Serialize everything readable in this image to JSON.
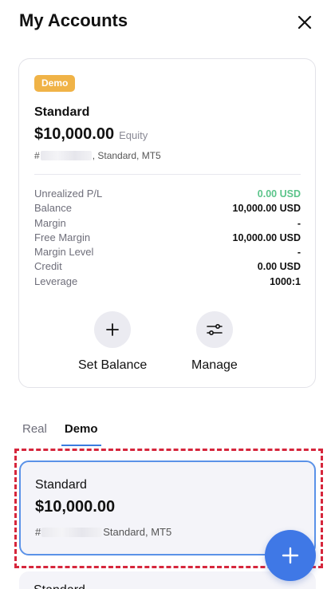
{
  "header": {
    "title": "My Accounts"
  },
  "account": {
    "badge": "Demo",
    "type": "Standard",
    "balance": "$10,000.00",
    "balance_label": "Equity",
    "id_prefix": "#",
    "meta": ", Standard, MT5",
    "stats": [
      {
        "label": "Unrealized P/L",
        "value": "0.00 USD"
      },
      {
        "label": "Balance",
        "value": "10,000.00 USD"
      },
      {
        "label": "Margin",
        "value": "-"
      },
      {
        "label": "Free Margin",
        "value": "10,000.00 USD"
      },
      {
        "label": "Margin Level",
        "value": "-"
      },
      {
        "label": "Credit",
        "value": "0.00 USD"
      },
      {
        "label": "Leverage",
        "value": "1000:1"
      }
    ],
    "actions": [
      {
        "label": "Set Balance",
        "icon": "plus-icon"
      },
      {
        "label": "Manage",
        "icon": "sliders-icon"
      }
    ]
  },
  "tabs": [
    {
      "label": "Real",
      "active": false
    },
    {
      "label": "Demo",
      "active": true
    }
  ],
  "list": {
    "items": [
      {
        "type": "Standard",
        "balance": "$10,000.00",
        "id_prefix": "#",
        "meta": "Standard, MT5"
      },
      {
        "type": "Standard"
      }
    ]
  },
  "colors": {
    "badge": "#f0b347",
    "accent": "#3f78e6",
    "positive": "#5bc48a",
    "highlight": "#d6263c"
  }
}
